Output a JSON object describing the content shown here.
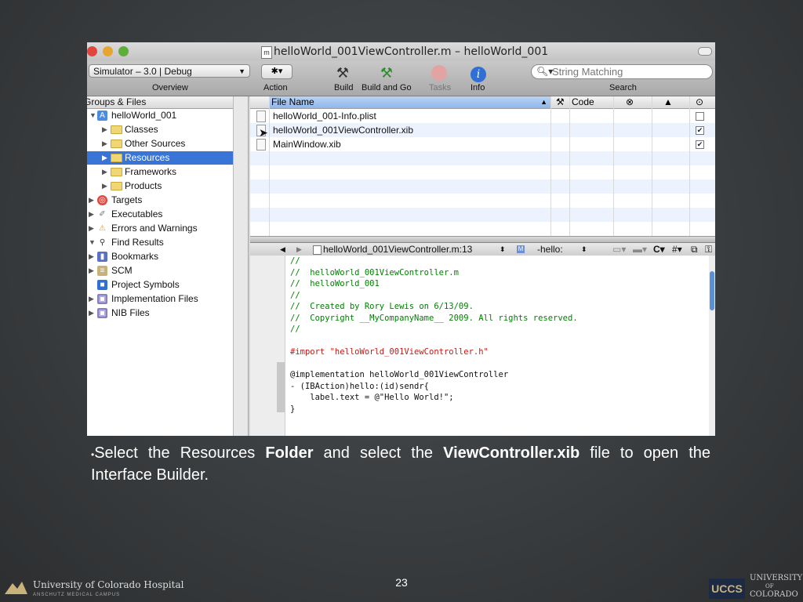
{
  "window": {
    "title": "helloWorld_001ViewController.m – helloWorld_001",
    "doc_icon": "m"
  },
  "toolbar": {
    "scheme": "Simulator – 3.0 | Debug",
    "overview_label": "Overview",
    "action_label": "Action",
    "build_label": "Build",
    "build_and_go_label": "Build and Go",
    "tasks_label": "Tasks",
    "info_label": "Info",
    "search_placeholder": "String Matching",
    "search_label": "Search"
  },
  "sidebar": {
    "header": "Groups & Files",
    "items": [
      {
        "label": "helloWorld_001",
        "icon": "project-icon"
      },
      {
        "label": "Classes",
        "icon": "folder-icon"
      },
      {
        "label": "Other Sources",
        "icon": "folder-icon"
      },
      {
        "label": "Resources",
        "icon": "folder-icon",
        "selected": true
      },
      {
        "label": "Frameworks",
        "icon": "folder-icon"
      },
      {
        "label": "Products",
        "icon": "folder-icon"
      },
      {
        "label": "Targets",
        "icon": "target-icon"
      },
      {
        "label": "Executables",
        "icon": "executables-icon"
      },
      {
        "label": "Errors and Warnings",
        "icon": "warning-icon"
      },
      {
        "label": "Find Results",
        "icon": "magnifier-icon"
      },
      {
        "label": "Bookmarks",
        "icon": "bookmarks-icon"
      },
      {
        "label": "SCM",
        "icon": "scm-icon"
      },
      {
        "label": "Project Symbols",
        "icon": "symbols-icon"
      },
      {
        "label": "Implementation Files",
        "icon": "smart-group-icon"
      },
      {
        "label": "NIB Files",
        "icon": "smart-group-icon"
      }
    ]
  },
  "file_table": {
    "columns": [
      "File Name",
      "Code"
    ],
    "rows": [
      {
        "name": "helloWorld_001-Info.plist",
        "checked": false
      },
      {
        "name": "helloWorld_001ViewController.xib",
        "checked": true
      },
      {
        "name": "MainWindow.xib",
        "checked": true
      }
    ]
  },
  "editor_nav": {
    "file": "helloWorld_001ViewController.m:13",
    "symbol_badge": "M",
    "symbol": "-hello:",
    "c_label": "C",
    "hash_label": "#"
  },
  "code_lines": [
    "//",
    "//  helloWorld_001ViewController.m",
    "//  helloWorld_001",
    "//",
    "//  Created by Rory Lewis on 6/13/09.",
    "//  Copyright __MyCompanyName__ 2009. All rights reserved.",
    "//",
    "",
    "#import \"helloWorld_001ViewController.h\"",
    "",
    "@implementation helloWorld_001ViewController",
    "- (IBAction)hello:(id)sendr{",
    "    label.text = @\"Hello World!\";",
    "}"
  ],
  "caption": {
    "bullet": "•",
    "part1": "Select the Resources ",
    "bold1": "Folder",
    "part2": " and select the ",
    "bold2": "ViewController.xib",
    "part3": " file to open the Interface Builder."
  },
  "page_number": "23",
  "footer": {
    "left_logo_text": "University of Colorado Hospital",
    "left_logo_subtext": "ANSCHUTZ MEDICAL CAMPUS",
    "right_logo_text": "UCCS",
    "right_logo_university": "UNIVERSITY",
    "right_logo_of": "OF",
    "right_logo_colorado": "COLORADO"
  },
  "colors": {
    "selection": "#3875d7",
    "comment": "#008000",
    "string": "#c41a16",
    "keyword": "#aa0d91",
    "preprocessor": "#643820"
  }
}
